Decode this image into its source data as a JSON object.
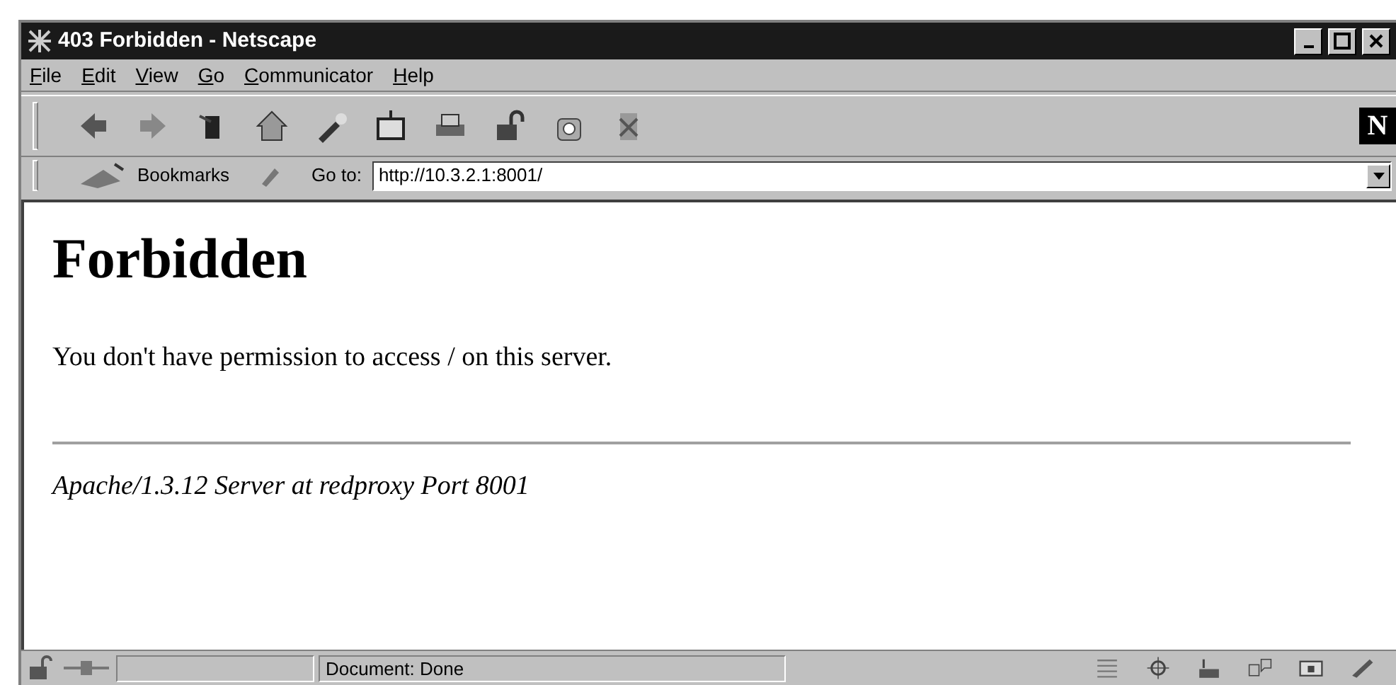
{
  "window": {
    "title": "403 Forbidden - Netscape"
  },
  "menu": [
    "File",
    "Edit",
    "View",
    "Go",
    "Communicator",
    "Help"
  ],
  "navigation_toolbar": {
    "logo": "N"
  },
  "location_bar": {
    "bookmarks_label": "Bookmarks",
    "goto_label": "Go to:",
    "url": "http://10.3.2.1:8001/"
  },
  "page": {
    "heading": "Forbidden",
    "message": "You don't have permission to access / on this server.",
    "address": "Apache/1.3.12 Server at redproxy Port 8001"
  },
  "status_bar": {
    "text": "Document: Done"
  }
}
